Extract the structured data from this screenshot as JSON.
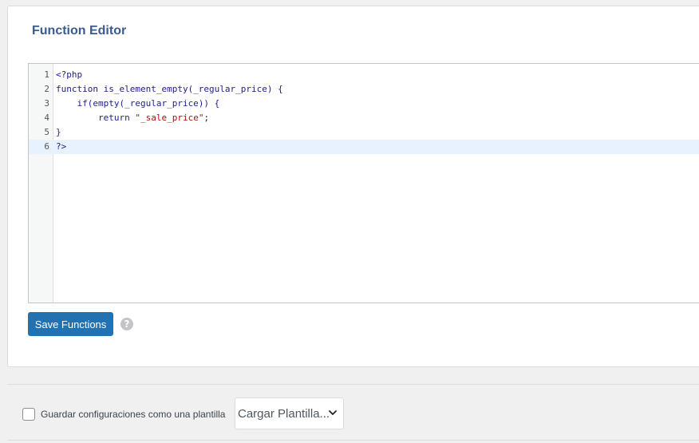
{
  "function_editor": {
    "title": "Function Editor",
    "lines": [
      {
        "number": "1",
        "code": "<?php"
      },
      {
        "number": "2",
        "code": "function is_element_empty(_regular_price) {"
      },
      {
        "number": "3",
        "code": "    if(empty(_regular_price)) {"
      },
      {
        "number": "4",
        "code_before": "        return ",
        "code_string": "\"_sale_price\"",
        "code_after": ";"
      },
      {
        "number": "5",
        "code": "}"
      },
      {
        "number": "6",
        "code": "?>"
      }
    ],
    "active_line": "6",
    "save_label": "Save Functions",
    "help_glyph": "?"
  },
  "template": {
    "checkbox_label": "Guardar configuraciones como una plantilla",
    "load_select_value": "Cargar Plantilla..."
  },
  "colors": {
    "accent": "#2271b1",
    "title": "#3c5a8e",
    "active_line_bg": "#e8f2fe"
  },
  "icons": {
    "help": "help-circle-icon",
    "dropdown": "chevron-down-icon"
  }
}
